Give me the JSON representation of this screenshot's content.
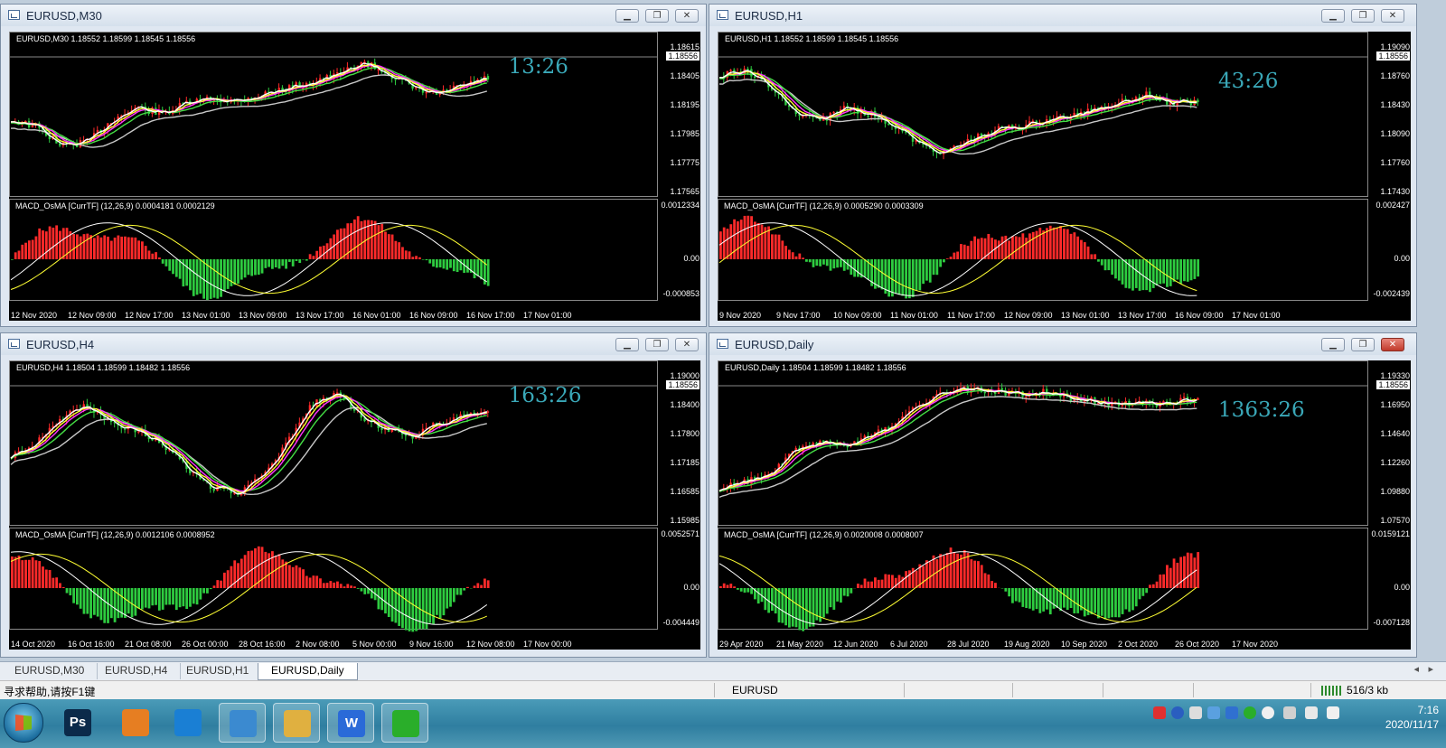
{
  "windows": [
    {
      "title": "EURUSD,M30",
      "ohlc": "EURUSD,M30  1.18552 1.18599 1.18545 1.18556",
      "price_labels": [
        "1.18615",
        "1.18405",
        "1.18195",
        "1.17985",
        "1.17775",
        "1.17565"
      ],
      "current_price": "1.18556",
      "macd_label": "MACD_OsMA [CurrTF] (12,26,9) 0.0004181 0.0002129",
      "macd_labels": [
        "0.0012334",
        "0.00",
        "-0.000853"
      ],
      "time_labels": [
        "12 Nov 2020",
        "12 Nov 09:00",
        "12 Nov 17:00",
        "13 Nov 01:00",
        "13 Nov 09:00",
        "13 Nov 17:00",
        "16 Nov 01:00",
        "16 Nov 09:00",
        "16 Nov 17:00",
        "17 Nov 01:00"
      ],
      "timer": "13:26"
    },
    {
      "title": "EURUSD,H1",
      "ohlc": "EURUSD,H1  1.18552 1.18599 1.18545 1.18556",
      "price_labels": [
        "1.19090",
        "1.18760",
        "1.18430",
        "1.18090",
        "1.17760",
        "1.17430"
      ],
      "current_price": "1.18556",
      "macd_label": "MACD_OsMA [CurrTF] (12,26,9) 0.0005290 0.0003309",
      "macd_labels": [
        "0.002427",
        "0.00",
        "-0.002439"
      ],
      "time_labels": [
        "9 Nov 2020",
        "9 Nov 17:00",
        "10 Nov 09:00",
        "11 Nov 01:00",
        "11 Nov 17:00",
        "12 Nov 09:00",
        "13 Nov 01:00",
        "13 Nov 17:00",
        "16 Nov 09:00",
        "17 Nov 01:00"
      ],
      "timer": "43:26"
    },
    {
      "title": "EURUSD,H4",
      "ohlc": "EURUSD,H4  1.18504 1.18599 1.18482 1.18556",
      "price_labels": [
        "1.19000",
        "1.18400",
        "1.17800",
        "1.17185",
        "1.16585",
        "1.15985"
      ],
      "current_price": "1.18556",
      "macd_label": "MACD_OsMA [CurrTF] (12,26,9) 0.0012106 0.0008952",
      "macd_labels": [
        "0.0052571",
        "0.00",
        "-0.004449"
      ],
      "time_labels": [
        "14 Oct 2020",
        "16 Oct 16:00",
        "21 Oct 08:00",
        "26 Oct 00:00",
        "28 Oct 16:00",
        "2 Nov 08:00",
        "5 Nov 00:00",
        "9 Nov 16:00",
        "12 Nov 08:00",
        "17 Nov 00:00"
      ],
      "timer": "163:26"
    },
    {
      "title": "EURUSD,Daily",
      "ohlc": "EURUSD,Daily  1.18504 1.18599 1.18482 1.18556",
      "price_labels": [
        "1.19330",
        "1.16950",
        "1.14640",
        "1.12260",
        "1.09880",
        "1.07570"
      ],
      "current_price": "1.18556",
      "macd_label": "MACD_OsMA [CurrTF] (12,26,9) 0.0020008 0.0008007",
      "macd_labels": [
        "0.0159121",
        "0.00",
        "-0.007128"
      ],
      "time_labels": [
        "29 Apr 2020",
        "21 May 2020",
        "12 Jun 2020",
        "6 Jul 2020",
        "28 Jul 2020",
        "19 Aug 2020",
        "10 Sep 2020",
        "2 Oct 2020",
        "26 Oct 2020",
        "17 Nov 2020"
      ],
      "timer": "1363:26"
    }
  ],
  "tabs": [
    "EURUSD,M30",
    "EURUSD,H4",
    "EURUSD,H1",
    "EURUSD,Daily"
  ],
  "active_tab": "EURUSD,Daily",
  "status": {
    "help": "寻求帮助,请按F1键",
    "symbol": "EURUSD",
    "traffic": "516/3 kb"
  },
  "taskbar": {
    "apps": [
      {
        "icon": "ps-icon",
        "label": "Ps",
        "color": "#0b2a4a"
      },
      {
        "icon": "bird-icon",
        "label": "",
        "color": "#e67e22"
      },
      {
        "icon": "cloud-icon",
        "label": "",
        "color": "#1a7fd4"
      },
      {
        "icon": "trading-app-icon",
        "label": "",
        "color": "#3b8ad0"
      },
      {
        "icon": "folder-icon",
        "label": "",
        "color": "#e0b040"
      },
      {
        "icon": "wps-icon",
        "label": "W",
        "color": "#2a6ad8"
      },
      {
        "icon": "wechat-icon",
        "label": "",
        "color": "#2aae2a"
      }
    ],
    "time": "7:16",
    "date": "2020/11/17"
  },
  "colors": {
    "bull": "#ff2a2a",
    "bear": "#2ecc40",
    "ma_white": "#ffffff",
    "ma_yellow": "#ffff33",
    "ma_magenta": "#ff33ff",
    "ma_green": "#44dd44",
    "ma_gray": "#c8c8c8",
    "timer": "#3aa8b8"
  }
}
